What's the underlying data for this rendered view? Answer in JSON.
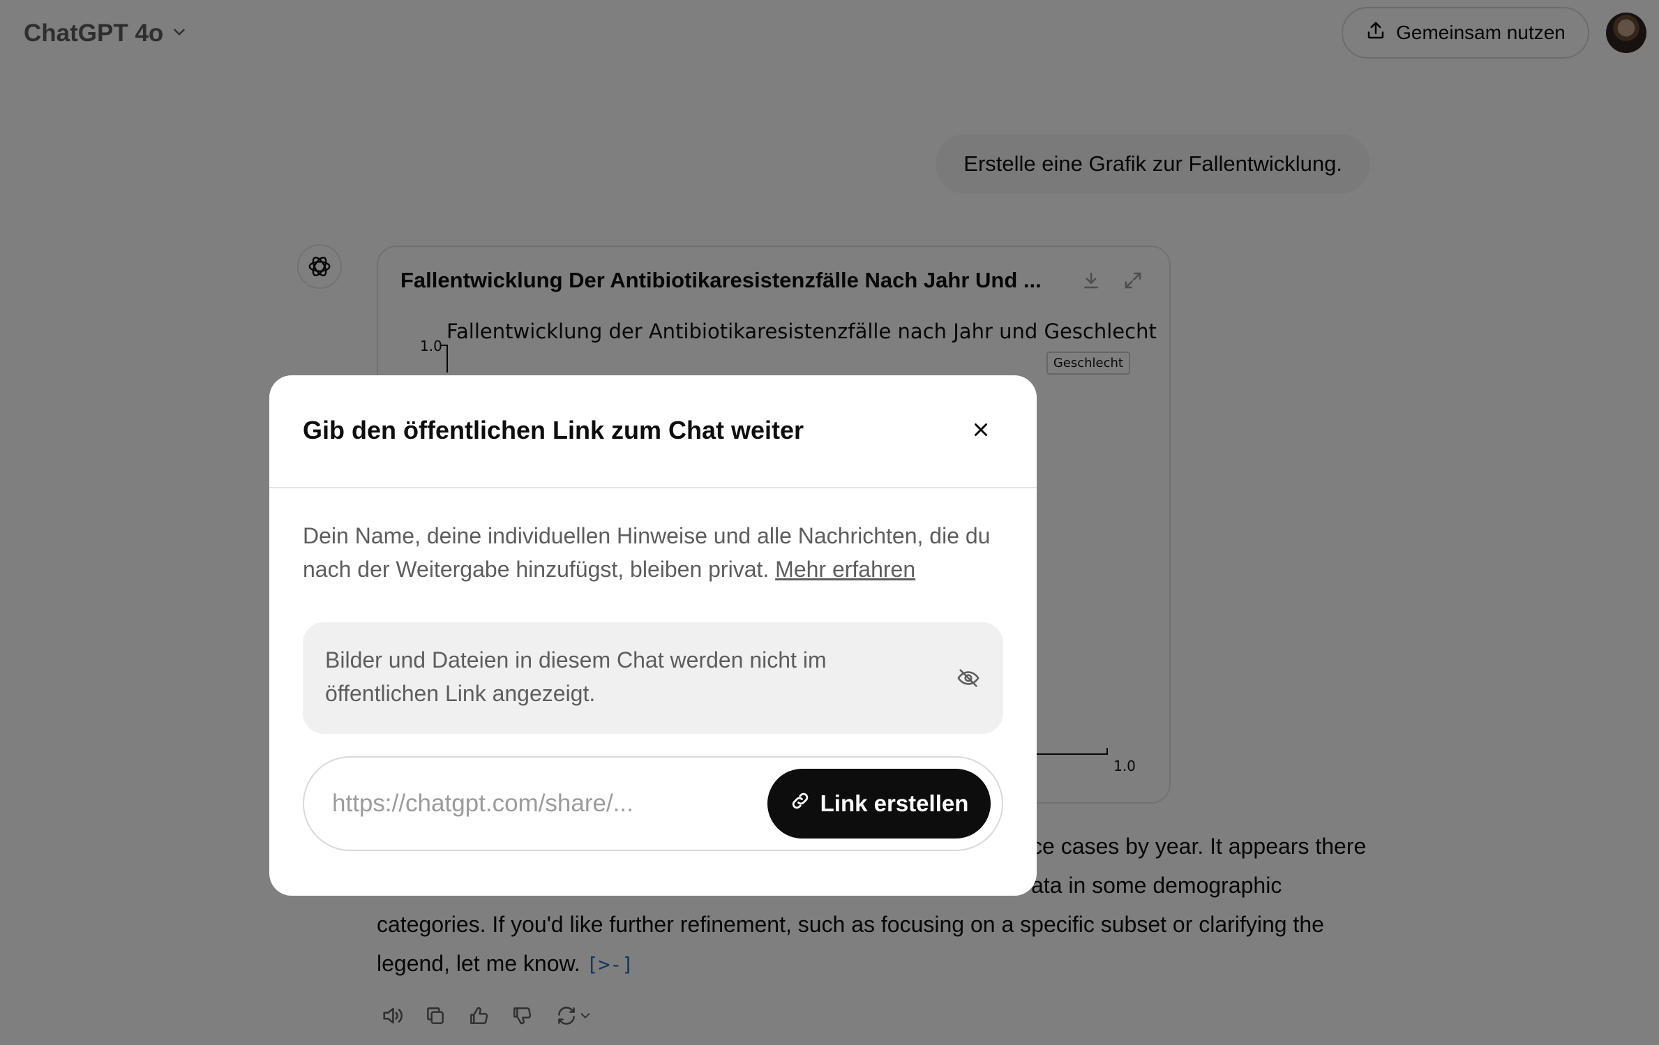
{
  "header": {
    "model_name": "ChatGPT 4o",
    "share_label": "Gemeinsam nutzen"
  },
  "chat": {
    "user_message": "Erstelle eine Grafik zur Fallentwicklung.",
    "chart_card": {
      "title": "Fallentwicklung Der Antibiotikaresistenzfälle Nach Jahr Und ...",
      "chart_title": "Fallentwicklung der Antibiotikaresistenzfälle nach Jahr und Geschlecht",
      "legend_title": "Geschlecht",
      "y_top_tick": "1.0",
      "x_right_tick": "1.0"
    },
    "reply_lines": [
      "ce cases by year. It appears there",
      "ata in some demographic",
      "categories. If you'd like further refinement, such as focusing on a specific subset or clarifying the",
      "legend, let me know."
    ],
    "code_ref": "[>-]"
  },
  "chart_data": {
    "type": "line",
    "title": "Fallentwicklung der Antibiotikaresistenzfälle nach Jahr und Geschlecht",
    "legend_title": "Geschlecht",
    "series": [],
    "ylim": [
      0,
      1.0
    ],
    "xlim": [
      0,
      1.0
    ]
  },
  "modal": {
    "title": "Gib den öffentlichen Link zum Chat weiter",
    "description": "Dein Name, deine individuellen Hinweise und alle Nachrichten, die du nach der Weitergabe hinzufügst, bleiben privat.",
    "learn_more": "Mehr erfahren",
    "notice": "Bilder und Dateien in diesem Chat werden nicht im öffentlichen Link angezeigt.",
    "link_placeholder": "https://chatgpt.com/share/...",
    "create_label": "Link erstellen"
  }
}
